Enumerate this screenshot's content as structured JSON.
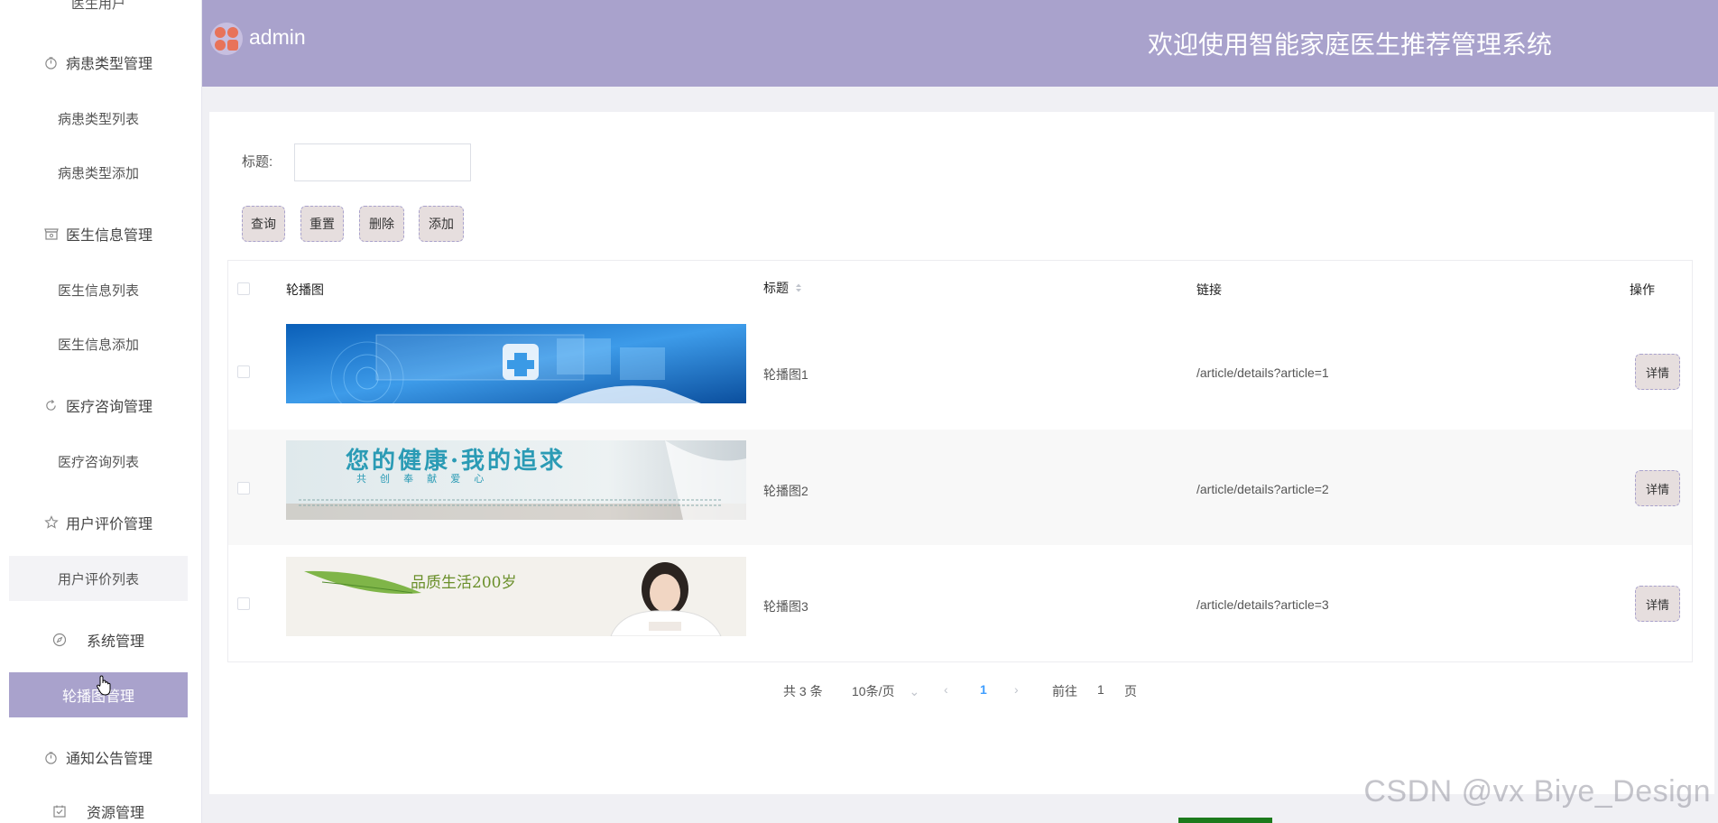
{
  "sidebar": {
    "top_partial": "医生用户",
    "items": [
      {
        "label": "病患类型管理",
        "icon": "timer-icon"
      },
      {
        "label": "病患类型列表"
      },
      {
        "label": "病患类型添加"
      },
      {
        "label": "医生信息管理",
        "icon": "storefront-icon"
      },
      {
        "label": "医生信息列表"
      },
      {
        "label": "医生信息添加"
      },
      {
        "label": "医疗咨询管理",
        "icon": "refresh-icon"
      },
      {
        "label": "医疗咨询列表"
      },
      {
        "label": "用户评价管理",
        "icon": "star-icon"
      },
      {
        "label": "用户评价列表"
      },
      {
        "label": "系统管理",
        "icon": "compass-icon"
      },
      {
        "label": "轮播图管理"
      },
      {
        "label": "通知公告管理",
        "icon": "timer-icon"
      },
      {
        "label": "资源管理",
        "icon": "checkbox-icon"
      }
    ]
  },
  "header": {
    "user": "admin",
    "title": "欢迎使用智能家庭医生推荐管理系统"
  },
  "search": {
    "label": "标题:",
    "value": ""
  },
  "buttons": {
    "query": "查询",
    "reset": "重置",
    "delete": "删除",
    "add": "添加"
  },
  "table": {
    "columns": [
      "轮播图",
      "标题",
      "链接",
      "操作"
    ],
    "rows": [
      {
        "title": "轮播图1",
        "link": "/article/details?article=1",
        "action": "详情"
      },
      {
        "title": "轮播图2",
        "link": "/article/details?article=2",
        "action": "详情"
      },
      {
        "title": "轮播图3",
        "link": "/article/details?article=3",
        "action": "详情"
      }
    ],
    "banner2_text": "您的健康·我的追求",
    "banner2_sub": "共 创 奉 献 爱 心",
    "banner3_text": "品质生活200岁"
  },
  "pagination": {
    "total": "共 3 条",
    "page_size": "10条/页",
    "current_page": "1",
    "goto_label": "前往",
    "goto_value": "1",
    "page_suffix": "页"
  },
  "watermark": "CSDN @vx Biye_Design",
  "colors": {
    "accent": "#a9a2cc",
    "button_bg": "#e6dede",
    "link_blue": "#409eff"
  }
}
